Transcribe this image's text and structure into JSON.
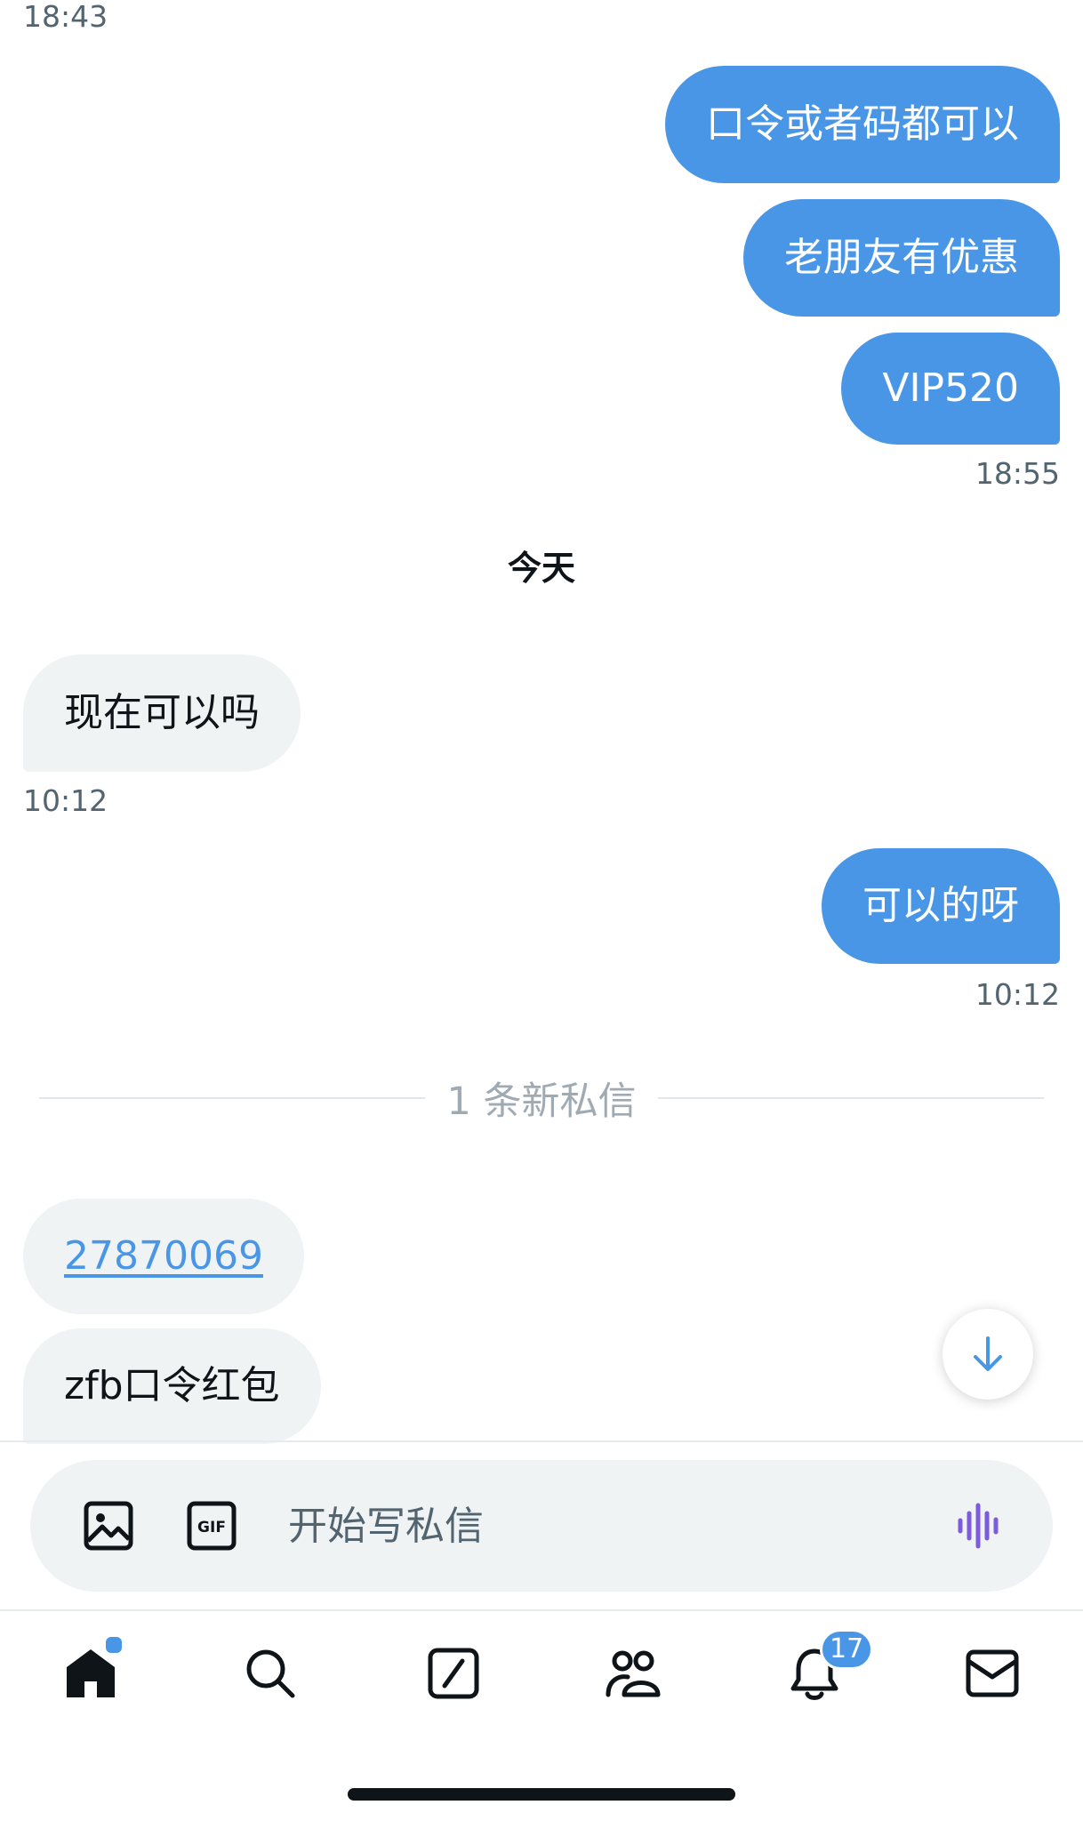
{
  "chat": {
    "top_timestamp": "18:43",
    "outgoing_group_1": [
      "口令或者码都可以",
      "老朋友有优惠",
      "VIP520"
    ],
    "outgoing_group_1_time": "18:55",
    "day_divider": "今天",
    "incoming_1": "现在可以吗",
    "incoming_1_time": "10:12",
    "outgoing_2": "可以的呀",
    "outgoing_2_time": "10:12",
    "new_messages_divider": "1 条新私信",
    "incoming_link": "27870069",
    "incoming_2": "zfb口令红包"
  },
  "composer": {
    "placeholder": "开始写私信",
    "image_icon": "image-icon",
    "gif_icon": "gif-icon",
    "gif_text": "GIF",
    "voice_icon": "voice-waveform-icon"
  },
  "tabbar": {
    "items": [
      "home-icon",
      "search-icon",
      "grok-icon",
      "communities-icon",
      "notifications-icon",
      "messages-icon"
    ],
    "notification_count": "17"
  },
  "colors": {
    "accent": "#4a96e6",
    "incoming_bubble": "#eff3f4",
    "voice_icon": "#7c5cdb"
  }
}
